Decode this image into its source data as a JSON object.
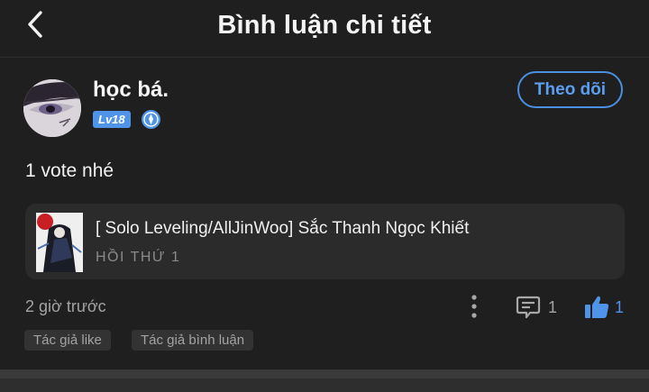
{
  "header": {
    "title": "Bình luận chi tiết",
    "back_icon": "chevron-left-icon"
  },
  "user": {
    "name": "học bá.",
    "level": "Lv18",
    "verified_icon": "verified-badge-icon",
    "follow_label": "Theo dõi"
  },
  "comment": {
    "text": "1 vote nhé"
  },
  "linked_story": {
    "title": "[ Solo Leveling/AllJinWoo] Sắc Thanh Ngọc Khiết",
    "chapter": "HỒI THỨ 1"
  },
  "footer": {
    "time": "2 giờ trước",
    "comment_count": "1",
    "like_count": "1",
    "more_icon": "more-vertical-icon",
    "comment_icon": "comment-icon",
    "like_icon": "thumbs-up-icon"
  },
  "tags": [
    "Tác giả like",
    "Tác giả bình luận"
  ],
  "colors": {
    "background": "#1f1f1f",
    "accent": "#4f94e8",
    "card": "#2b2b2b",
    "muted_text": "#a3a3a3"
  }
}
